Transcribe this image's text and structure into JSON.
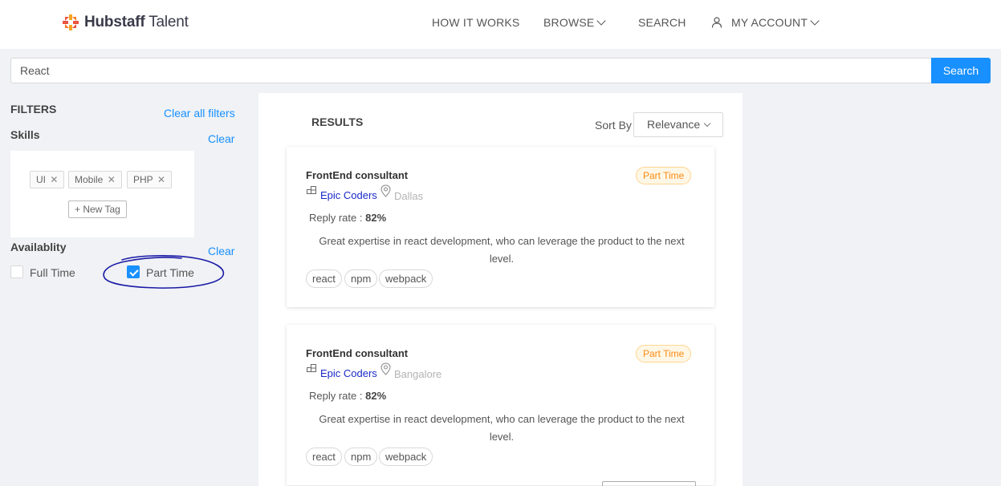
{
  "brand": {
    "bold": "Hubstaff",
    "light": "Talent"
  },
  "nav": {
    "how_it_works": "HOW IT WORKS",
    "browse": "BROWSE",
    "search": "SEARCH",
    "my_account": "MY ACCOUNT"
  },
  "search": {
    "value": "React",
    "button": "Search"
  },
  "filters": {
    "title": "FILTERS",
    "clear_all": "Clear all filters",
    "skills": {
      "title": "Skills",
      "clear": "Clear",
      "tags": [
        "UI",
        "Mobile",
        "PHP"
      ],
      "new_tag": "New Tag"
    },
    "availability": {
      "title": "Availablity",
      "clear": "Clear",
      "options": [
        {
          "label": "Full Time",
          "checked": false
        },
        {
          "label": "Part Time",
          "checked": true
        }
      ]
    }
  },
  "results": {
    "title": "RESULTS",
    "sort_label": "Sort By",
    "sort_value": "Relevance",
    "items": [
      {
        "title": "FrontEnd consultant",
        "badge": "Part Time",
        "company": "Epic Coders",
        "location": "Dallas",
        "reply_label": "Reply rate :",
        "reply_value": "82%",
        "description": "Great expertise in react development, who can leverage the product to the next level.",
        "skills": [
          "react",
          "npm",
          "webpack"
        ]
      },
      {
        "title": "FrontEnd consultant",
        "badge": "Part Time",
        "company": "Epic Coders",
        "location": "Bangalore",
        "reply_label": "Reply rate :",
        "reply_value": "82%",
        "description": "Great expertise in react development, who can leverage the product to the next level.",
        "skills": [
          "react",
          "npm",
          "webpack"
        ]
      }
    ]
  },
  "colors": {
    "accent": "#1890ff",
    "badge_text": "#fa8c16",
    "company_link": "#1a29c7",
    "annotation": "#1a1aa6"
  }
}
